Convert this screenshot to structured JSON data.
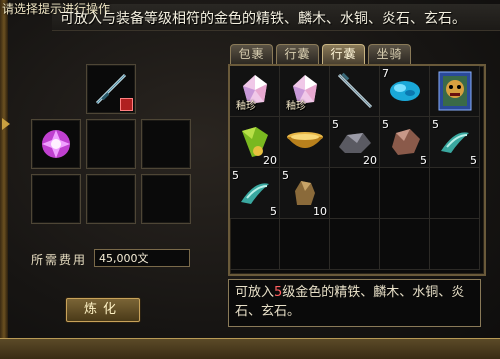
{
  "hint": "请选择提示进行操作",
  "top_description": "可放入与装备等级相符的金色的精铁、麟木、水铜、炎石、玄石。",
  "tabs": [
    {
      "label": "包裹",
      "active": false
    },
    {
      "label": "行囊",
      "active": false
    },
    {
      "label": "行囊",
      "active": true
    },
    {
      "label": "坐骑",
      "active": false
    }
  ],
  "inventory": [
    {
      "name": "crystal-item-1",
      "rare": "釉珍",
      "qty": "",
      "stack": ""
    },
    {
      "name": "crystal-item-2",
      "rare": "釉珍",
      "qty": "",
      "stack": ""
    },
    {
      "name": "sword-item",
      "rare": "",
      "qty": "",
      "stack": ""
    },
    {
      "name": "blue-stone-item",
      "rare": "",
      "qty": "",
      "stack": "7"
    },
    {
      "name": "demon-card-item",
      "rare": "",
      "qty": "",
      "stack": ""
    },
    {
      "name": "green-scroll-item",
      "rare": "",
      "qty": "20",
      "stack": ""
    },
    {
      "name": "golden-bowl-item",
      "rare": "",
      "qty": "",
      "stack": ""
    },
    {
      "name": "iron-ore-item",
      "rare": "",
      "qty": "20",
      "stack": "5"
    },
    {
      "name": "copper-ore-item",
      "rare": "",
      "qty": "5",
      "stack": "5"
    },
    {
      "name": "jade-ornament-item-1",
      "rare": "",
      "qty": "5",
      "stack": "5"
    },
    {
      "name": "jade-ornament-item-2",
      "rare": "",
      "qty": "5",
      "stack": "5"
    },
    {
      "name": "beast-figure-item",
      "rare": "",
      "qty": "10",
      "stack": "5"
    }
  ],
  "fee": {
    "label": "所需费用",
    "value": "45,000文"
  },
  "smelt_button": "炼化",
  "description": {
    "before": "可放入",
    "highlight": "5",
    "after": "级金色的精铁、麟木、水铜、炎石、玄石。"
  },
  "colors": {
    "accent": "#c8a25a",
    "highlight": "#ff6060",
    "panel": "#0a0a0a"
  }
}
